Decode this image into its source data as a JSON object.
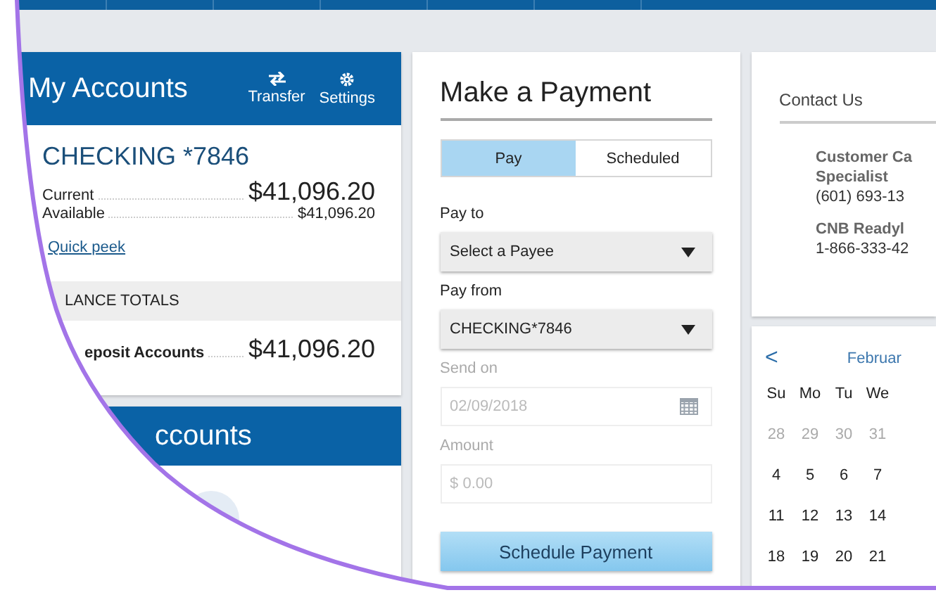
{
  "accounts_card": {
    "title": "My Accounts",
    "actions": [
      {
        "label": "Transfer"
      },
      {
        "label": "Settings"
      }
    ],
    "account": {
      "name": "CHECKING *7846",
      "rows": [
        {
          "label": "Current",
          "amount": "$41,096.20",
          "kind": "large"
        },
        {
          "label": "Available",
          "amount": "$41,096.20",
          "kind": "small"
        }
      ],
      "link": "Quick peek"
    },
    "totals_heading": "LANCE TOTALS",
    "totals": [
      {
        "label": "eposit Accounts",
        "amount": "$41,096.20"
      }
    ]
  },
  "second_card": {
    "title": "ccounts"
  },
  "payment": {
    "title": "Make a Payment",
    "tabs": [
      {
        "label": "Pay",
        "selected": true
      },
      {
        "label": "Scheduled",
        "selected": false
      }
    ],
    "fields": [
      {
        "kind": "select",
        "label": "Pay to",
        "value": "Select a Payee",
        "disabled": false
      },
      {
        "kind": "select",
        "label": "Pay from",
        "value": "CHECKING*7846",
        "disabled": false
      },
      {
        "kind": "date",
        "label": "Send on",
        "placeholder": "02/09/2018",
        "disabled": true
      },
      {
        "kind": "text",
        "label": "Amount",
        "placeholder": "$ 0.00",
        "disabled": true
      }
    ],
    "button": "Schedule Payment"
  },
  "contact": {
    "title": "Contact Us",
    "entries": [
      {
        "lines": [
          "Customer Ca",
          "Specialist"
        ],
        "phone": "(601) 693-13"
      },
      {
        "lines": [
          "CNB Readyl"
        ],
        "phone": "1-866-333-42"
      }
    ]
  },
  "calendar": {
    "prev": "<",
    "month": "Februar",
    "weekdays": [
      "Su",
      "Mo",
      "Tu",
      "We"
    ],
    "weeks": [
      [
        {
          "day": "28",
          "outside": true
        },
        {
          "day": "29",
          "outside": true
        },
        {
          "day": "30",
          "outside": true
        },
        {
          "day": "31",
          "outside": true
        }
      ],
      [
        {
          "day": "4",
          "outside": false
        },
        {
          "day": "5",
          "outside": false
        },
        {
          "day": "6",
          "outside": false
        },
        {
          "day": "7",
          "outside": false
        }
      ],
      [
        {
          "day": "11",
          "outside": false
        },
        {
          "day": "12",
          "outside": false
        },
        {
          "day": "13",
          "outside": false
        },
        {
          "day": "14",
          "outside": false
        }
      ],
      [
        {
          "day": "18",
          "outside": false
        },
        {
          "day": "19",
          "outside": false
        },
        {
          "day": "20",
          "outside": false
        },
        {
          "day": "21",
          "outside": false
        }
      ]
    ]
  }
}
